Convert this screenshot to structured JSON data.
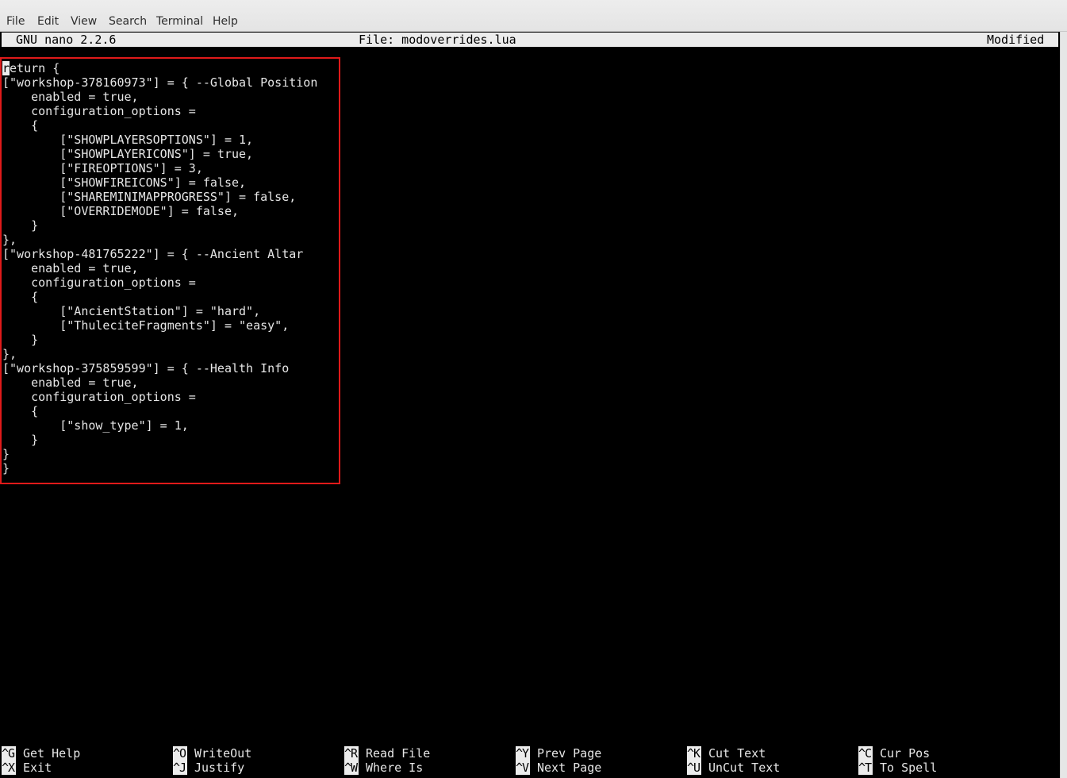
{
  "menubar": {
    "items": [
      "File",
      "Edit",
      "View",
      "Search",
      "Terminal",
      "Help"
    ]
  },
  "nano": {
    "version": "GNU nano 2.2.6",
    "file_label": "File: modoverrides.lua",
    "status": "Modified"
  },
  "editor": {
    "cursor_char": "r",
    "lines": [
      "eturn {",
      "[\"workshop-378160973\"] = { --Global Position",
      "    enabled = true,",
      "    configuration_options =",
      "    {",
      "        [\"SHOWPLAYERSOPTIONS\"] = 1,",
      "        [\"SHOWPLAYERICONS\"] = true,",
      "        [\"FIREOPTIONS\"] = 3,",
      "        [\"SHOWFIREICONS\"] = false,",
      "        [\"SHAREMINIMAPPROGRESS\"] = false,",
      "        [\"OVERRIDEMODE\"] = false,",
      "    }",
      "},",
      "[\"workshop-481765222\"] = { --Ancient Altar",
      "    enabled = true,",
      "    configuration_options =",
      "    {",
      "        [\"AncientStation\"] = \"hard\",",
      "        [\"ThuleciteFragments\"] = \"easy\",",
      "    }",
      "},",
      "[\"workshop-375859599\"] = { --Health Info",
      "    enabled = true,",
      "    configuration_options =",
      "    {",
      "        [\"show_type\"] = 1,",
      "    }",
      "}",
      "}"
    ]
  },
  "shortcuts": [
    {
      "key": "^G",
      "label": "Get Help"
    },
    {
      "key": "^O",
      "label": "WriteOut"
    },
    {
      "key": "^R",
      "label": "Read File"
    },
    {
      "key": "^Y",
      "label": "Prev Page"
    },
    {
      "key": "^K",
      "label": "Cut Text"
    },
    {
      "key": "^C",
      "label": "Cur Pos"
    },
    {
      "key": "^X",
      "label": "Exit"
    },
    {
      "key": "^J",
      "label": "Justify"
    },
    {
      "key": "^W",
      "label": "Where Is"
    },
    {
      "key": "^V",
      "label": "Next Page"
    },
    {
      "key": "^U",
      "label": "UnCut Text"
    },
    {
      "key": "^T",
      "label": "To Spell"
    }
  ],
  "colors": {
    "terminal_bg": "#000000",
    "terminal_fg": "#e6e6e6",
    "inverse_bg": "#ececec",
    "highlight_border": "#e01a1a"
  }
}
